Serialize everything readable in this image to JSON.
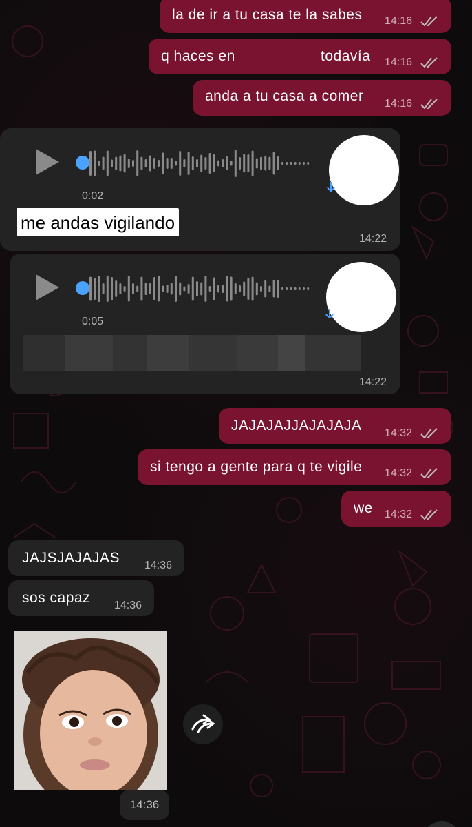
{
  "colors": {
    "outgoing_bubble": "#7a1330",
    "incoming_bubble": "#232323",
    "background": "#0d0b0c",
    "voice_dot": "#4aa3ff"
  },
  "messages_out_top": [
    {
      "text": "la de ir a tu casa te la sabes",
      "time": "14:16",
      "status": "read-ticks-icon"
    },
    {
      "text_before": "q haces en",
      "text_after": "todavía",
      "time": "14:16",
      "status": "read-ticks-icon"
    },
    {
      "text": "anda a tu casa a comer",
      "time": "14:16",
      "status": "read-ticks-icon"
    }
  ],
  "voice_messages": [
    {
      "duration": "0:02",
      "transcript": "me andas vigilando",
      "time": "14:22"
    },
    {
      "duration": "0:05",
      "transcript": "",
      "time": "14:22"
    }
  ],
  "messages_out_mid": [
    {
      "text": "JAJAJAJJAJAJAJA",
      "time": "14:32",
      "status": "read-ticks-icon"
    },
    {
      "text": "si tengo a gente para q te vigile",
      "time": "14:32",
      "status": "read-ticks-icon"
    },
    {
      "text": "we",
      "time": "14:32",
      "status": "read-ticks-icon"
    }
  ],
  "messages_in": [
    {
      "text": "JAJSJAJAJAS",
      "time": "14:36"
    },
    {
      "text": "sos capaz",
      "time": "14:36"
    }
  ],
  "photo_message": {
    "time": "14:36",
    "forward_icon": "forward-icon"
  }
}
